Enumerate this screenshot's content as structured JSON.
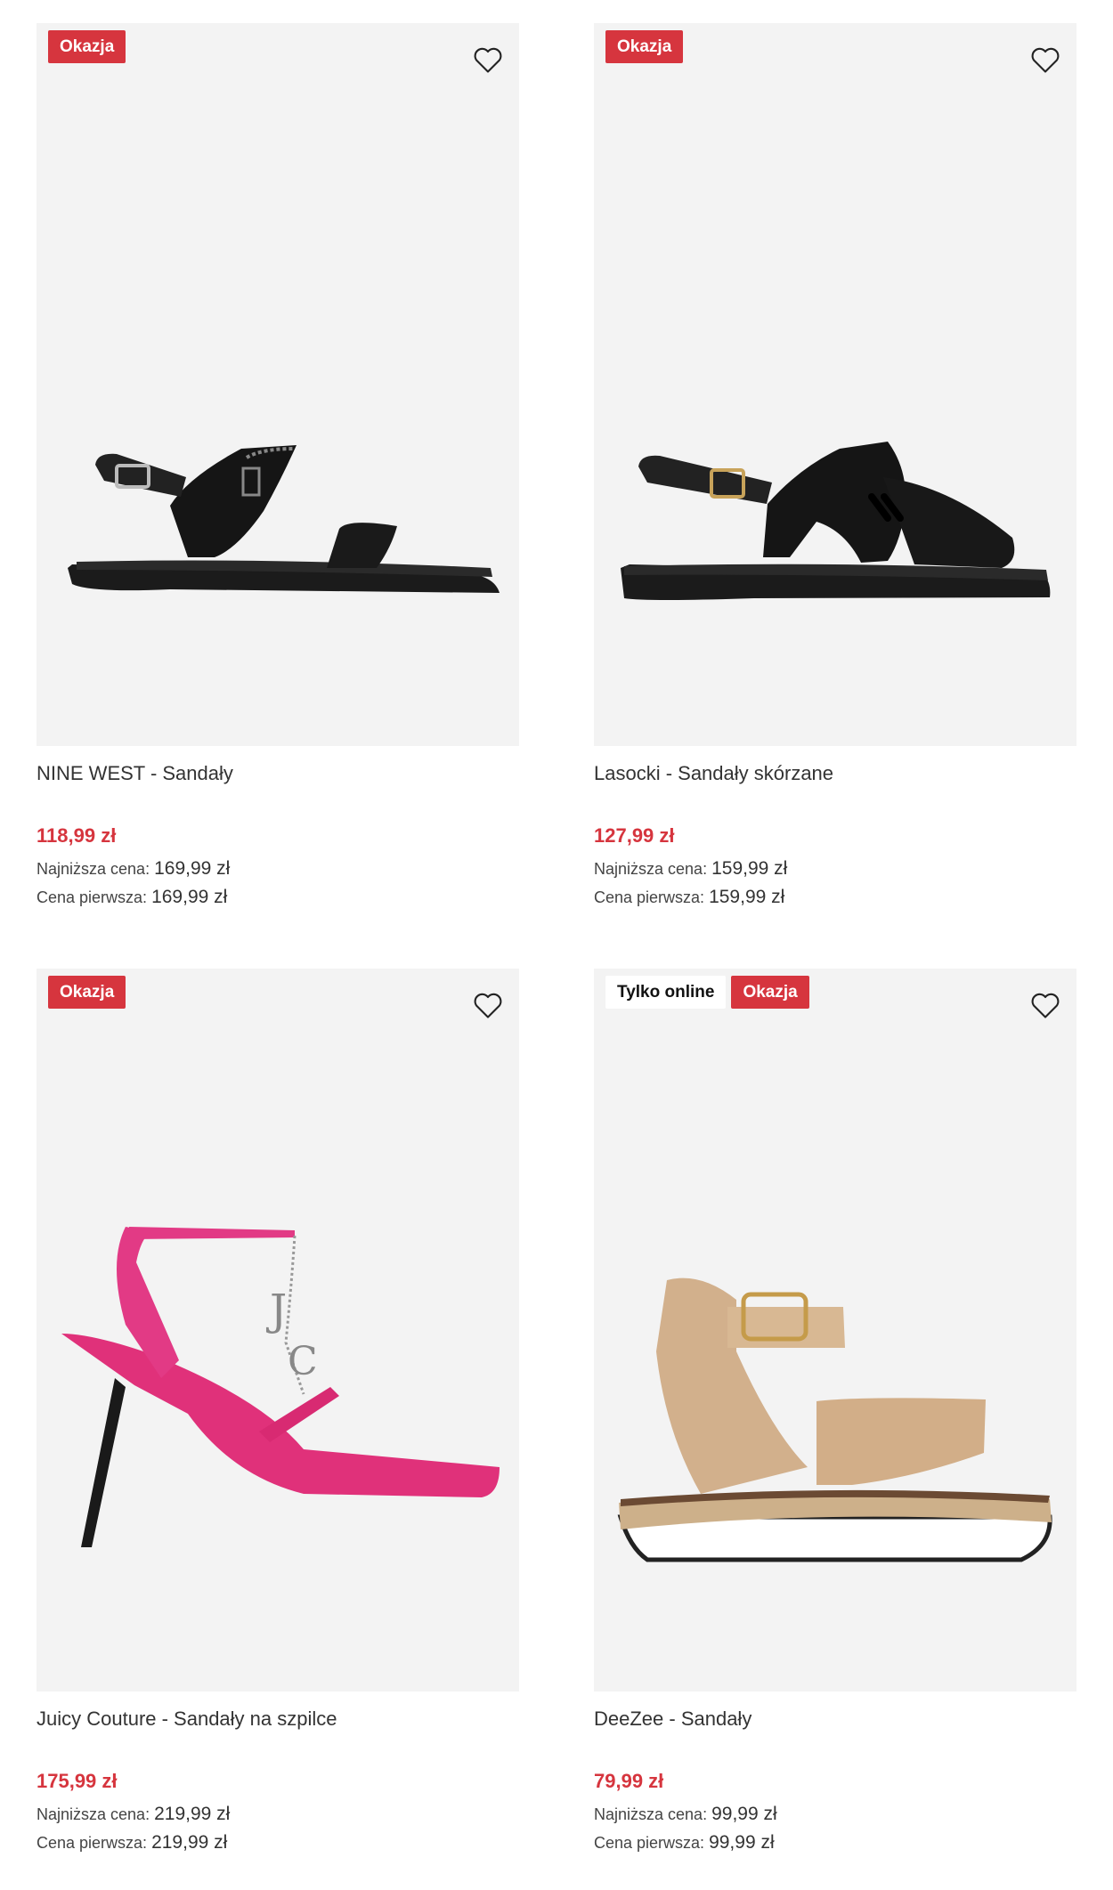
{
  "colors": {
    "accent_red": "#d6353e",
    "image_bg": "#f3f3f3"
  },
  "products": [
    {
      "title": "NINE WEST - Sandały",
      "badges": [
        "Okazja"
      ],
      "price": "118,99 zł",
      "lowest_label": "Najniższa cena:",
      "lowest_value": "169,99 zł",
      "first_label": "Cena pierwsza:",
      "first_value": "169,99 zł",
      "favorite_icon": "heart-outline-icon"
    },
    {
      "title": "Lasocki - Sandały skórzane",
      "badges": [
        "Okazja"
      ],
      "price": "127,99 zł",
      "lowest_label": "Najniższa cena:",
      "lowest_value": "159,99 zł",
      "first_label": "Cena pierwsza:",
      "first_value": "159,99 zł",
      "favorite_icon": "heart-outline-icon"
    },
    {
      "title": "Juicy Couture - Sandały na szpilce",
      "badges": [
        "Okazja"
      ],
      "price": "175,99 zł",
      "lowest_label": "Najniższa cena:",
      "lowest_value": "219,99 zł",
      "first_label": "Cena pierwsza:",
      "first_value": "219,99 zł",
      "favorite_icon": "heart-outline-icon"
    },
    {
      "title": "DeeZee - Sandały",
      "badges": [
        "Tylko online",
        "Okazja"
      ],
      "price": "79,99 zł",
      "lowest_label": "Najniższa cena:",
      "lowest_value": "99,99 zł",
      "first_label": "Cena pierwsza:",
      "first_value": "99,99 zł",
      "favorite_icon": "heart-outline-icon"
    }
  ]
}
